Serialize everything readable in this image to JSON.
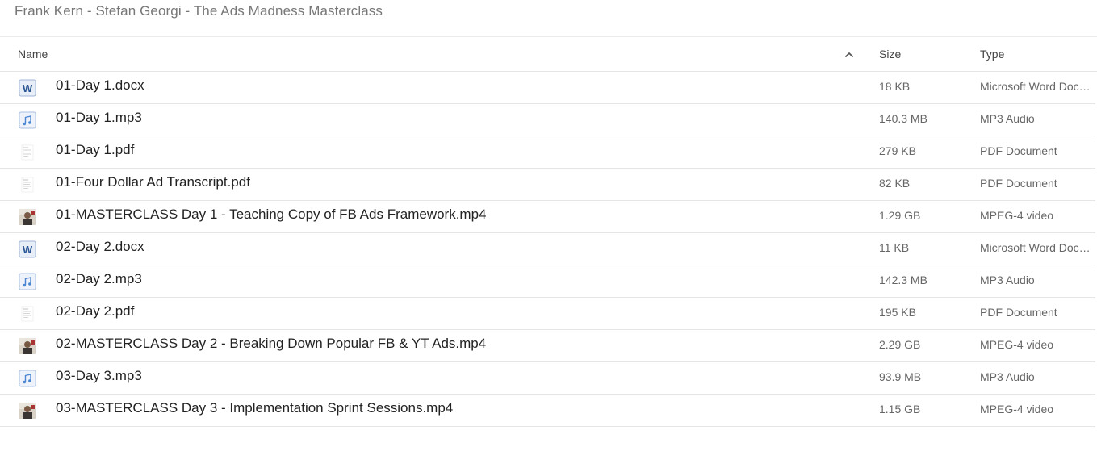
{
  "breadcrumb": "Frank Kern - Stefan Georgi - The Ads Madness Masterclass",
  "columns": {
    "name": "Name",
    "size": "Size",
    "type": "Type"
  },
  "sort": {
    "column": "name",
    "direction": "ascending",
    "icon": "chevron-up-icon"
  },
  "files": [
    {
      "name": "01-Day 1.docx",
      "size": "18 KB",
      "type": "Microsoft Word Document",
      "icon": "word-doc-icon"
    },
    {
      "name": "01-Day 1.mp3",
      "size": "140.3 MB",
      "type": "MP3 Audio",
      "icon": "audio-file-icon"
    },
    {
      "name": "01-Day 1.pdf",
      "size": "279 KB",
      "type": "PDF Document",
      "icon": "pdf-thumbnail-icon"
    },
    {
      "name": "01-Four Dollar Ad Transcript.pdf",
      "size": "82 KB",
      "type": "PDF Document",
      "icon": "pdf-thumbnail-icon"
    },
    {
      "name": "01-MASTERCLASS Day 1 - Teaching Copy of FB Ads Framework.mp4",
      "size": "1.29 GB",
      "type": "MPEG-4 video",
      "icon": "video-thumbnail-icon"
    },
    {
      "name": "02-Day 2.docx",
      "size": "11 KB",
      "type": "Microsoft Word Document",
      "icon": "word-doc-icon"
    },
    {
      "name": "02-Day 2.mp3",
      "size": "142.3 MB",
      "type": "MP3 Audio",
      "icon": "audio-file-icon"
    },
    {
      "name": "02-Day 2.pdf",
      "size": "195 KB",
      "type": "PDF Document",
      "icon": "pdf-thumbnail-icon"
    },
    {
      "name": "02-MASTERCLASS Day 2 - Breaking Down Popular FB & YT Ads.mp4",
      "size": "2.29 GB",
      "type": "MPEG-4 video",
      "icon": "video-thumbnail-icon"
    },
    {
      "name": "03-Day 3.mp3",
      "size": "93.9 MB",
      "type": "MP3 Audio",
      "icon": "audio-file-icon"
    },
    {
      "name": "03-MASTERCLASS Day 3 - Implementation Sprint Sessions.mp4",
      "size": "1.15 GB",
      "type": "MPEG-4 video",
      "icon": "video-thumbnail-icon"
    }
  ],
  "colors": {
    "word_blue": "#2b5797",
    "audio_blue": "#4a86d4",
    "divider": "#e6e6e6",
    "breadcrumb_text": "#777777"
  }
}
